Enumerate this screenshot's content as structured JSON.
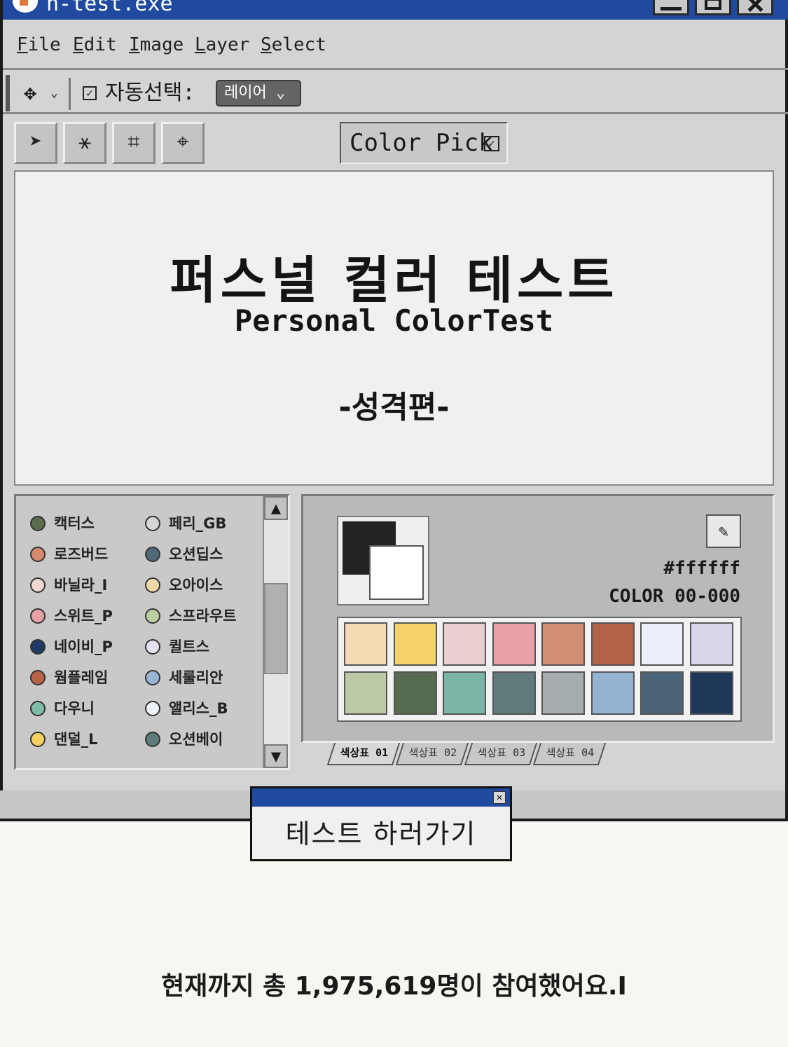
{
  "window": {
    "title": "h-test.exe"
  },
  "menu": [
    "File",
    "Edit",
    "Image",
    "Layer",
    "Select"
  ],
  "options": {
    "auto_select_label": "자동선택:",
    "layer_dropdown": "레이어"
  },
  "toolbar": {
    "color_pick_label": "Color Pick"
  },
  "canvas": {
    "title_ko": "퍼스널 컬러 테스트",
    "title_en": "Personal ColorTest",
    "subtitle": "-성격편-"
  },
  "personality_list": [
    {
      "label": "캑터스",
      "color": "#5a6e4e"
    },
    {
      "label": "페리_GB",
      "color": "#d6d6d6"
    },
    {
      "label": "로즈버드",
      "color": "#d88a70"
    },
    {
      "label": "오션딥스",
      "color": "#4e6a78"
    },
    {
      "label": "바닐라_I",
      "color": "#f1d6d2"
    },
    {
      "label": "오아이스",
      "color": "#f0d8a8"
    },
    {
      "label": "스위트_P",
      "color": "#e9a0a6"
    },
    {
      "label": "스프라우트",
      "color": "#bccfa2"
    },
    {
      "label": "네이비_P",
      "color": "#1f3a64"
    },
    {
      "label": "퀼트스",
      "color": "#e6e0f0"
    },
    {
      "label": "웜플레임",
      "color": "#b96448"
    },
    {
      "label": "세룰리안",
      "color": "#9ab6d4"
    },
    {
      "label": "다우니",
      "color": "#80bcaa"
    },
    {
      "label": "앨리스_B",
      "color": "#eef4fc"
    },
    {
      "label": "댄덜_L",
      "color": "#f6d060"
    },
    {
      "label": "오션베이",
      "color": "#5e7c7c"
    }
  ],
  "color_panel": {
    "hex": "#ffffff",
    "color_code": "COLOR 00-000",
    "foreground_color": "#222222",
    "background_color": "#ffffff",
    "swatches": [
      "#f3dbb3",
      "#f6d26a",
      "#e9cfcf",
      "#e8a1a8",
      "#d38d75",
      "#b26249",
      "#e9eef8",
      "#d9d6ec",
      "#bccba5",
      "#566b4f",
      "#7ab4a7",
      "#617b7c",
      "#a4adaf",
      "#94b3d2",
      "#4c6477",
      "#1e3758"
    ],
    "tabs": [
      "색상표 01",
      "색상표 02",
      "색상표 03",
      "색상표 04"
    ]
  },
  "dialog": {
    "button_label": "테스트 하러가기"
  },
  "footer": {
    "participants_text": "현재까지 총 1,975,619명이 참여했어요.I"
  }
}
